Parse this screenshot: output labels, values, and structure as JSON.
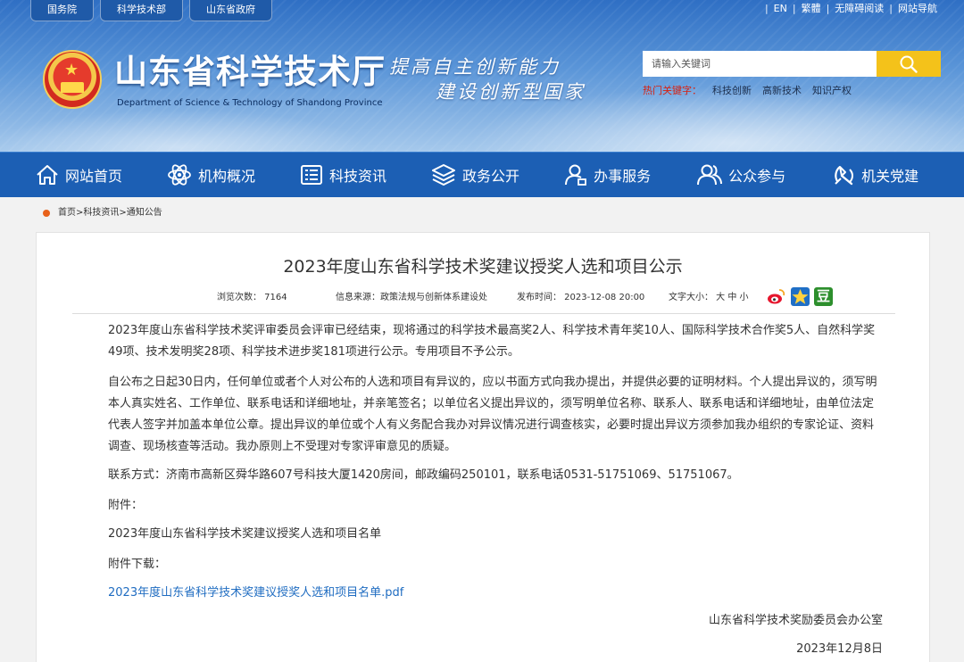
{
  "header": {
    "top_tabs": [
      "国务院",
      "科学技术部",
      "山东省政府"
    ],
    "top_links": [
      "EN",
      "繁體",
      "无障碍阅读",
      "网站导航"
    ],
    "site_title": "山东省科学技术厅",
    "site_subtitle": "Department of Science & Technology of Shandong Province",
    "slogan_line1": "提高自主创新能力",
    "slogan_line2": "建设创新型国家",
    "search_placeholder": "请输入关键词",
    "hotwords_label": "热门关键字：",
    "hotwords": [
      "科技创新",
      "高新技术",
      "知识产权"
    ]
  },
  "nav": {
    "items": [
      {
        "label": "网站首页",
        "icon": "home-icon"
      },
      {
        "label": "机构概况",
        "icon": "atom-icon"
      },
      {
        "label": "科技资讯",
        "icon": "news-icon"
      },
      {
        "label": "政务公开",
        "icon": "layers-icon"
      },
      {
        "label": "办事服务",
        "icon": "user-service-icon"
      },
      {
        "label": "公众参与",
        "icon": "people-icon"
      },
      {
        "label": "机关党建",
        "icon": "party-emblem-icon"
      }
    ]
  },
  "breadcrumb": "首页>科技资讯>通知公告",
  "article": {
    "title": "2023年度山东省科学技术奖建议授奖人选和项目公示",
    "views": "浏览次数：  7164",
    "source": "信息来源：政策法规与创新体系建设处",
    "date": "发布时间：  2023-12-08 20:00",
    "font_size": "文字大小：  大 中 小",
    "share_douban": "豆",
    "paragraphs": [
      "2023年度山东省科学技术奖评审委员会评审已经结束，现将通过的科学技术最高奖2人、科学技术青年奖10人、国际科学技术合作奖5人、自然科学奖49项、技术发明奖28项、科学技术进步奖181项进行公示。专用项目不予公示。",
      "自公布之日起30日内，任何单位或者个人对公布的人选和项目有异议的，应以书面方式向我办提出，并提供必要的证明材料。个人提出异议的，须写明本人真实姓名、工作单位、联系电话和详细地址，并亲笔签名；以单位名义提出异议的，须写明单位名称、联系人、联系电话和详细地址，由单位法定代表人签字并加盖本单位公章。提出异议的单位或个人有义务配合我办对异议情况进行调查核实，必要时提出异议方须参加我办组织的专家论证、资料调查、现场核查等活动。我办原则上不受理对专家评审意见的质疑。",
      "联系方式：济南市高新区舜华路607号科技大厦1420房间，邮政编码250101，联系电话0531-51751069、51751067。",
      "附件：",
      "2023年度山东省科学技术奖建议授奖人选和项目名单",
      "附件下载："
    ],
    "attachment_link": "2023年度山东省科学技术奖建议授奖人选和项目名单.pdf",
    "signature": "山东省科学技术奖励委员会办公室",
    "sign_date": "2023年12月8日"
  }
}
